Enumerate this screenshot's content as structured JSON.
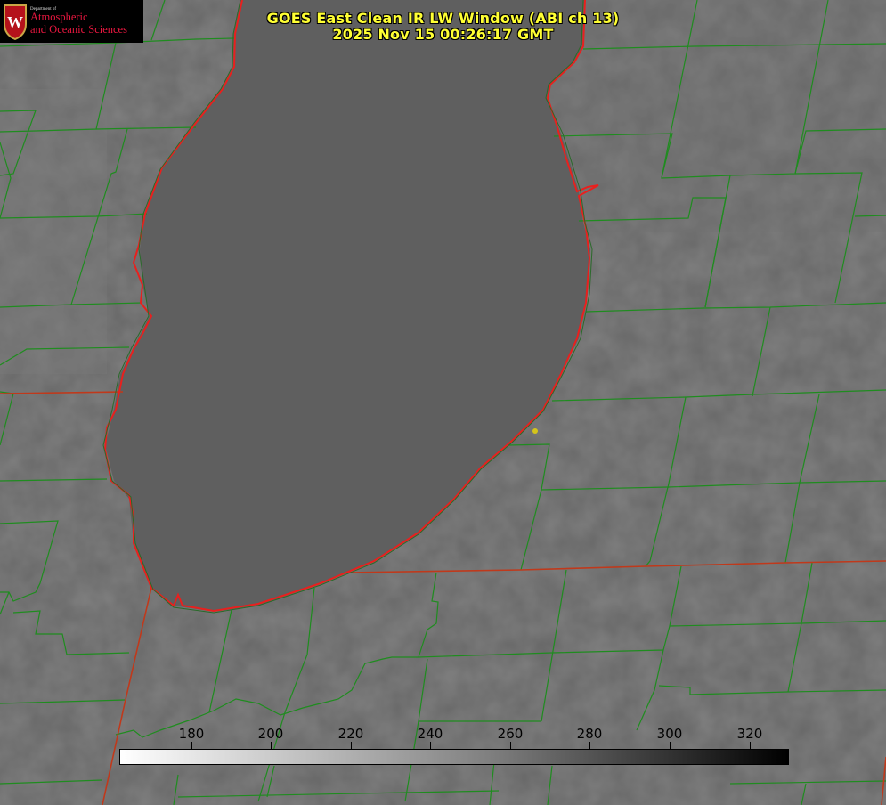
{
  "header": {
    "title_line1": "GOES East Clean IR LW Window (ABI ch 13)",
    "title_line2": "2025 Nov 15 00:26:17 GMT"
  },
  "logo": {
    "dept": "Department of",
    "line1": "Atmospheric",
    "line2": "and Oceanic Sciences",
    "shield_letter": "W",
    "accent_color": "#e8173f"
  },
  "colorbar": {
    "ticks": [
      "180",
      "200",
      "220",
      "240",
      "260",
      "280",
      "300",
      "320"
    ]
  },
  "colors": {
    "county_lines": "#1f8c1f",
    "state_lines": "#c0391b",
    "coastline": "#e8201e",
    "marker": "#d4c41a",
    "title": "#ffff33"
  }
}
